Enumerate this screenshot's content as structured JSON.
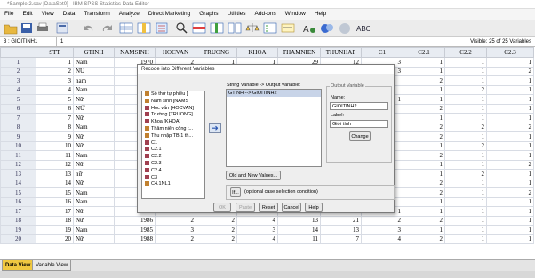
{
  "window": {
    "title": "*Sample 2.sav [DataSet0] - IBM SPSS Statistics Data Editor"
  },
  "menu": [
    "File",
    "Edit",
    "View",
    "Data",
    "Transform",
    "Analyze",
    "Direct Marketing",
    "Graphs",
    "Utilities",
    "Add-ons",
    "Window",
    "Help"
  ],
  "cellbar": {
    "ref": "3 : GIOITINH1",
    "value": "1",
    "visible": "Visible: 25 of 25 Variables"
  },
  "grid": {
    "columns": [
      "STT",
      "GTINH",
      "NAMSINH",
      "HOCVAN",
      "TRUONG",
      "KHOA",
      "THAMNIEN",
      "THUNHAP",
      "C1",
      "C2.1",
      "C2.2",
      "C2.3"
    ],
    "rows": [
      {
        "n": "1",
        "stt": "1",
        "g": "Nam",
        "ns": "1970",
        "hv": "2",
        "tr": "1",
        "kh": "1",
        "tn": "29",
        "th": "12",
        "c1": "3",
        "c21": "1",
        "c22": "1",
        "c23": "1"
      },
      {
        "n": "2",
        "stt": "2",
        "g": "NU",
        "ns": "",
        "hv": "",
        "tr": "",
        "kh": "",
        "tn": "",
        "th": "",
        "c1": "3",
        "c21": "1",
        "c22": "1",
        "c23": "2"
      },
      {
        "n": "3",
        "stt": "3",
        "g": "nam",
        "ns": "",
        "hv": "",
        "tr": "",
        "kh": "",
        "tn": "",
        "th": "",
        "c1": "",
        "c21": "2",
        "c22": "1",
        "c23": "1"
      },
      {
        "n": "4",
        "stt": "4",
        "g": "Nam",
        "ns": "",
        "hv": "",
        "tr": "",
        "kh": "",
        "tn": "",
        "th": "",
        "c1": "",
        "c21": "1",
        "c22": "2",
        "c23": "1"
      },
      {
        "n": "5",
        "stt": "5",
        "g": "Nữ",
        "ns": "",
        "hv": "",
        "tr": "",
        "kh": "",
        "tn": "",
        "th": "",
        "c1": "1",
        "c21": "1",
        "c22": "1",
        "c23": "1"
      },
      {
        "n": "6",
        "stt": "6",
        "g": "NỮ",
        "ns": "",
        "hv": "",
        "tr": "",
        "kh": "",
        "tn": "",
        "th": "",
        "c1": "",
        "c21": "2",
        "c22": "1",
        "c23": "1"
      },
      {
        "n": "7",
        "stt": "7",
        "g": "Nữ",
        "ns": "",
        "hv": "",
        "tr": "",
        "kh": "",
        "tn": "",
        "th": "",
        "c1": "",
        "c21": "1",
        "c22": "1",
        "c23": "1"
      },
      {
        "n": "8",
        "stt": "8",
        "g": "Nam",
        "ns": "",
        "hv": "",
        "tr": "",
        "kh": "",
        "tn": "",
        "th": "",
        "c1": "",
        "c21": "2",
        "c22": "2",
        "c23": "2"
      },
      {
        "n": "9",
        "stt": "9",
        "g": "Nữ",
        "ns": "",
        "hv": "",
        "tr": "",
        "kh": "",
        "tn": "",
        "th": "",
        "c1": "",
        "c21": "2",
        "c22": "1",
        "c23": "1"
      },
      {
        "n": "10",
        "stt": "10",
        "g": "Nữ",
        "ns": "",
        "hv": "",
        "tr": "",
        "kh": "",
        "tn": "",
        "th": "",
        "c1": "",
        "c21": "1",
        "c22": "2",
        "c23": "1"
      },
      {
        "n": "11",
        "stt": "11",
        "g": "Nam",
        "ns": "",
        "hv": "",
        "tr": "",
        "kh": "",
        "tn": "",
        "th": "",
        "c1": "",
        "c21": "2",
        "c22": "1",
        "c23": "1"
      },
      {
        "n": "12",
        "stt": "12",
        "g": "Nữ",
        "ns": "",
        "hv": "",
        "tr": "",
        "kh": "",
        "tn": "",
        "th": "",
        "c1": "",
        "c21": "1",
        "c22": "1",
        "c23": "2"
      },
      {
        "n": "13",
        "stt": "13",
        "g": "nữ",
        "ns": "",
        "hv": "",
        "tr": "",
        "kh": "",
        "tn": "",
        "th": "",
        "c1": "",
        "c21": "1",
        "c22": "2",
        "c23": "1"
      },
      {
        "n": "14",
        "stt": "14",
        "g": "Nữ",
        "ns": "",
        "hv": "",
        "tr": "",
        "kh": "",
        "tn": "",
        "th": "",
        "c1": "",
        "c21": "2",
        "c22": "1",
        "c23": "1"
      },
      {
        "n": "15",
        "stt": "15",
        "g": "Nam",
        "ns": "",
        "hv": "",
        "tr": "",
        "kh": "",
        "tn": "",
        "th": "",
        "c1": "",
        "c21": "2",
        "c22": "1",
        "c23": "2"
      },
      {
        "n": "16",
        "stt": "16",
        "g": "Nam",
        "ns": "",
        "hv": "",
        "tr": "",
        "kh": "",
        "tn": "",
        "th": "",
        "c1": "",
        "c21": "1",
        "c22": "1",
        "c23": "1"
      },
      {
        "n": "17",
        "stt": "17",
        "g": "Nữ",
        "ns": "1985",
        "hv": "3",
        "tr": "2",
        "kh": "3",
        "tn": "14",
        "th": "13",
        "c1": "1",
        "c21": "1",
        "c22": "1",
        "c23": "1"
      },
      {
        "n": "18",
        "stt": "18",
        "g": "Nữ",
        "ns": "1986",
        "hv": "2",
        "tr": "2",
        "kh": "4",
        "tn": "13",
        "th": "21",
        "c1": "2",
        "c21": "2",
        "c22": "1",
        "c23": "1"
      },
      {
        "n": "19",
        "stt": "19",
        "g": "Nam",
        "ns": "1985",
        "hv": "3",
        "tr": "2",
        "kh": "3",
        "tn": "14",
        "th": "13",
        "c1": "3",
        "c21": "1",
        "c22": "1",
        "c23": "1"
      },
      {
        "n": "20",
        "stt": "20",
        "g": "Nữ",
        "ns": "1988",
        "hv": "2",
        "tr": "2",
        "kh": "4",
        "tn": "11",
        "th": "7",
        "c1": "4",
        "c21": "2",
        "c22": "1",
        "c23": "1"
      }
    ]
  },
  "dialog": {
    "title": "Recode into Different Variables",
    "variables": [
      "Số thứ tự phiếu [",
      "Năm sinh [NAMS",
      "Học vấn [HOCVAN]",
      "Trường [TRUONG]",
      "Khoa [KHOA]",
      "Thâm niên công t...",
      "Thu nhập TB 1 th...",
      "C1",
      "C2.1",
      "C2.2",
      "C2.3",
      "C2.4",
      "C3",
      "C4.1NL1"
    ],
    "mapping_label": "String Variable -> Output Variable:",
    "mapping_item": "GTINH --> GIOITINH2",
    "output_group": "Output Variable",
    "name_label": "Name:",
    "name_value": "GIOITINH2",
    "label_label": "Label:",
    "label_value": "Giới tính",
    "change": "Change",
    "old_new": "Old and New Values...",
    "if_btn": "If...",
    "if_text": "(optional case selection condition)",
    "ok": "OK",
    "paste": "Paste",
    "reset": "Reset",
    "cancel": "Cancel",
    "help": "Help"
  },
  "tabs": {
    "data": "Data View",
    "variable": "Variable View"
  }
}
